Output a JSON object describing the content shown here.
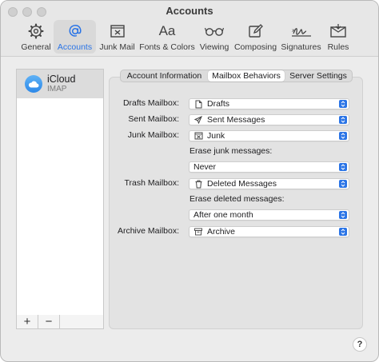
{
  "window": {
    "title": "Accounts"
  },
  "toolbar": {
    "items": [
      {
        "label": "General",
        "icon": "gear-icon"
      },
      {
        "label": "Accounts",
        "icon": "at-sign-icon",
        "active": true
      },
      {
        "label": "Junk Mail",
        "icon": "junk-mail-icon"
      },
      {
        "label": "Fonts & Colors",
        "icon": "fonts-icon",
        "glyph": "Aa"
      },
      {
        "label": "Viewing",
        "icon": "glasses-icon"
      },
      {
        "label": "Composing",
        "icon": "composing-icon"
      },
      {
        "label": "Signatures",
        "icon": "signature-icon"
      },
      {
        "label": "Rules",
        "icon": "rules-icon"
      }
    ]
  },
  "accounts": {
    "items": [
      {
        "name": "iCloud",
        "type": "IMAP",
        "icon": "icloud-icon"
      }
    ],
    "add_label": "+",
    "remove_label": "−"
  },
  "tabs": {
    "account_information": "Account Information",
    "mailbox_behaviors": "Mailbox Behaviors",
    "server_settings": "Server Settings"
  },
  "form": {
    "drafts": {
      "label": "Drafts Mailbox:",
      "value": "Drafts",
      "icon": "document-icon"
    },
    "sent": {
      "label": "Sent Mailbox:",
      "value": "Sent Messages",
      "icon": "paper-plane-icon"
    },
    "junk": {
      "label": "Junk Mailbox:",
      "value": "Junk",
      "icon": "junk-tray-icon"
    },
    "erase_junk": {
      "label": "Erase junk messages:",
      "value": "Never"
    },
    "trash": {
      "label": "Trash Mailbox:",
      "value": "Deleted Messages",
      "icon": "trash-icon"
    },
    "erase_deleted": {
      "label": "Erase deleted messages:",
      "value": "After one month"
    },
    "archive": {
      "label": "Archive Mailbox:",
      "value": "Archive",
      "icon": "archive-box-icon"
    }
  },
  "help": {
    "label": "?"
  },
  "colors": {
    "accent": "#2a74e6",
    "popup_chevron": "#2a74e6"
  }
}
